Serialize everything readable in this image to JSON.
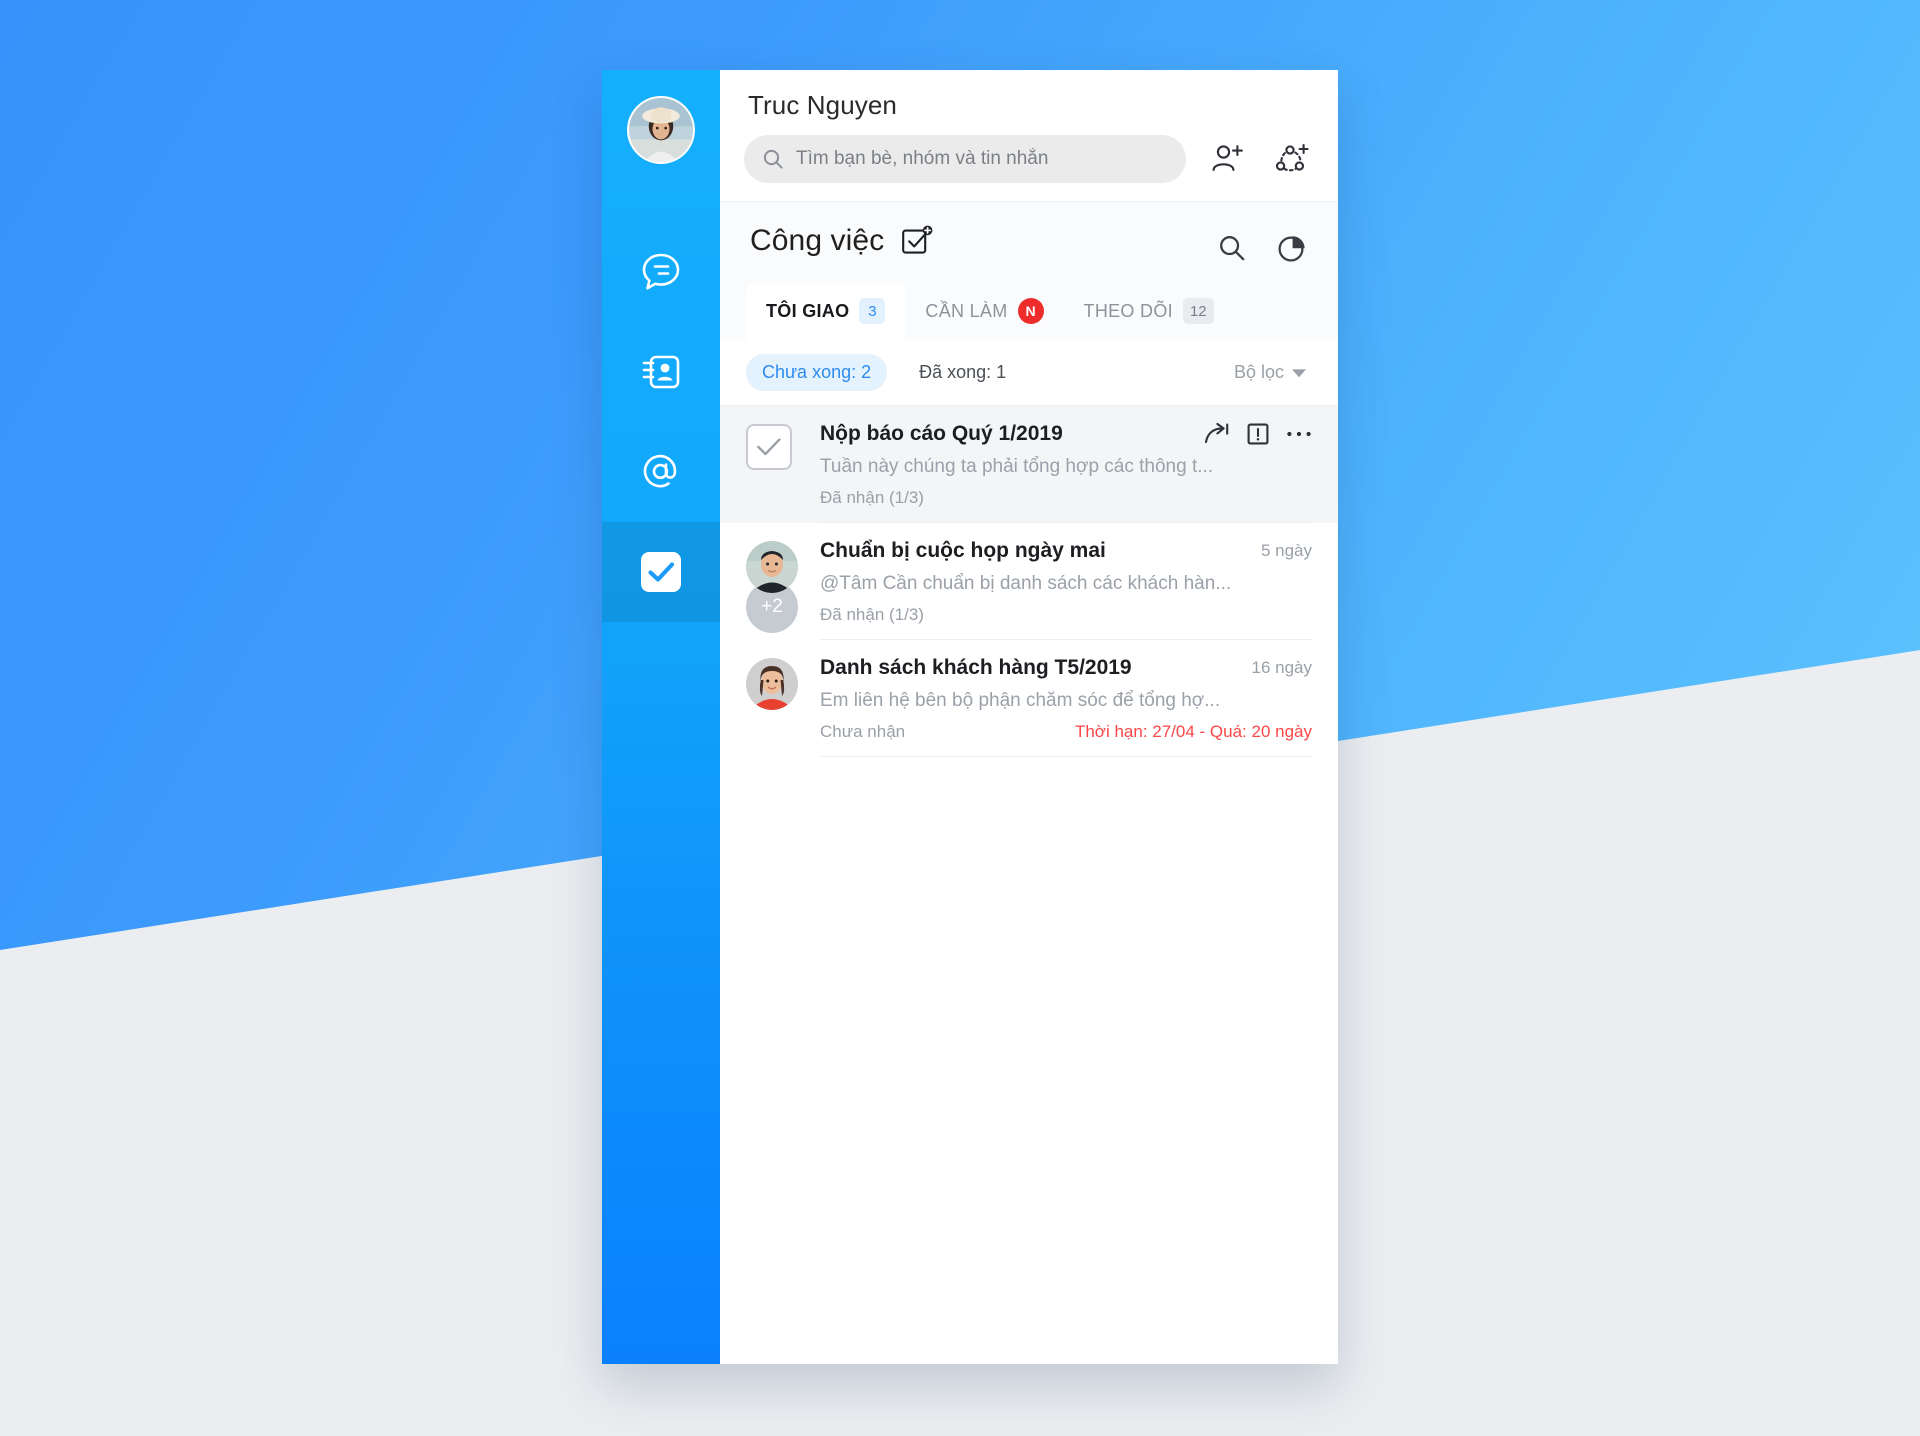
{
  "background": {
    "gradient_from": "#3793FB",
    "gradient_to": "#63C9FE",
    "lower_panel_color": "#EBEDF0"
  },
  "rail": {
    "avatar_name": "user-avatar",
    "items": [
      {
        "icon": "chat-bubble-icon",
        "name": "messages",
        "active": false
      },
      {
        "icon": "contacts-book-icon",
        "name": "contacts",
        "active": false
      },
      {
        "icon": "at-mention-icon",
        "name": "mentions",
        "active": false
      },
      {
        "icon": "checkbox-task-icon",
        "name": "tasks",
        "active": true
      }
    ]
  },
  "account": {
    "name": "Truc Nguyen"
  },
  "search": {
    "placeholder": "Tìm bạn bè, nhóm và tin nhắn",
    "icon": "search-icon"
  },
  "header_actions": [
    {
      "icon": "add-friend-icon",
      "name": "add-friend"
    },
    {
      "icon": "create-group-icon",
      "name": "create-group"
    }
  ],
  "section": {
    "title": "Công việc",
    "title_icon": "add-task-checkbox-icon",
    "actions": [
      {
        "icon": "search-icon",
        "name": "search-tasks"
      },
      {
        "icon": "pie-chart-icon",
        "name": "task-statistics"
      }
    ]
  },
  "tabs": [
    {
      "label": "TÔI GIAO",
      "badge": "3",
      "badge_style": "blue",
      "active": true
    },
    {
      "label": "CẦN LÀM",
      "badge": "N",
      "badge_style": "dot-red",
      "active": false
    },
    {
      "label": "THEO DÕI",
      "badge": "12",
      "badge_style": "gray",
      "active": false
    }
  ],
  "filters": {
    "pending": "Chưa xong: 2",
    "done": "Đã xong: 1",
    "sort": "Bộ lọc",
    "sort_icon": "chevron-down-icon"
  },
  "tasks": [
    {
      "title": "Nộp báo cáo Quý 1/2019",
      "description": "Tuần này chúng ta phải tổng hợp các thông t...",
      "status": "Đã nhận (1/3)",
      "time": "",
      "due": "",
      "highlight": true,
      "leading": "checkbox",
      "actions": [
        {
          "icon": "forward-arrow-icon",
          "name": "forward-task"
        },
        {
          "icon": "priority-exclamation-icon",
          "name": "task-priority"
        },
        {
          "icon": "ellipsis-icon",
          "name": "task-more-options"
        }
      ]
    },
    {
      "title": "Chuẩn bị cuộc họp ngày mai",
      "description": "@Tâm Cần chuẩn bị danh sách các khách hàn...",
      "status": "Đã nhận (1/3)",
      "time": "5 ngày",
      "due": "",
      "highlight": false,
      "leading": "avatar-male",
      "extra_members": "+2",
      "actions": []
    },
    {
      "title": "Danh sách khách hàng T5/2019",
      "description": "Em liên hệ bên bộ phận chăm sóc để tổng hợ...",
      "status": "Chưa nhận",
      "time": "16 ngày",
      "due": "Thời hạn: 27/04 - Quá: 20 ngày",
      "highlight": false,
      "leading": "avatar-female",
      "actions": []
    }
  ],
  "colors": {
    "accent_blue": "#2D8CF0",
    "danger_red": "#FB4747",
    "badge_red": "#EE2C2C"
  }
}
